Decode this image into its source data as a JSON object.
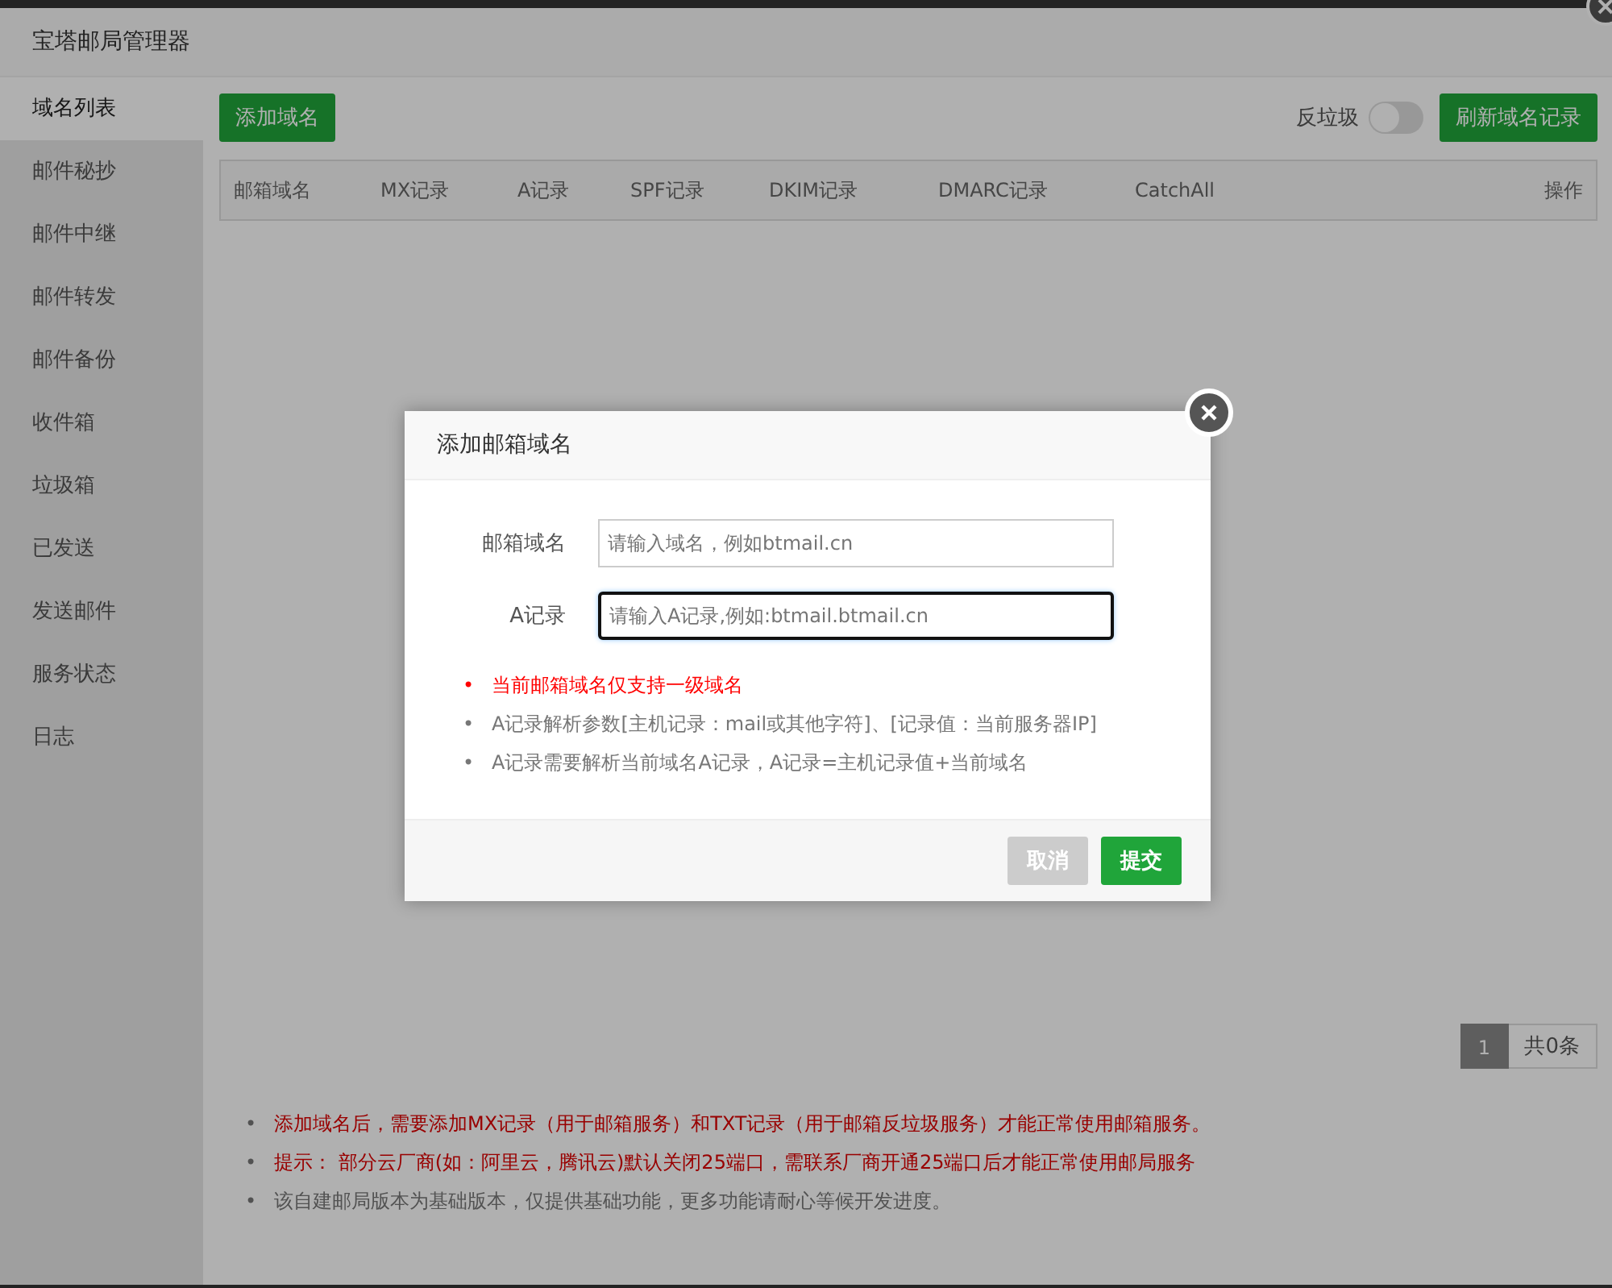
{
  "window": {
    "title": "宝塔邮局管理器"
  },
  "sidebar": {
    "items": [
      {
        "label": "域名列表",
        "selected": true
      },
      {
        "label": "邮件秘抄",
        "selected": false
      },
      {
        "label": "邮件中继",
        "selected": false
      },
      {
        "label": "邮件转发",
        "selected": false
      },
      {
        "label": "邮件备份",
        "selected": false
      },
      {
        "label": "收件箱",
        "selected": false
      },
      {
        "label": "垃圾箱",
        "selected": false
      },
      {
        "label": "已发送",
        "selected": false
      },
      {
        "label": "发送邮件",
        "selected": false
      },
      {
        "label": "服务状态",
        "selected": false
      },
      {
        "label": "日志",
        "selected": false
      }
    ]
  },
  "toolbar": {
    "add_button": "添加域名",
    "antispam": {
      "label": "反垃圾",
      "on": false
    },
    "refresh_button": "刷新域名记录"
  },
  "table": {
    "columns": [
      "邮箱域名",
      "MX记录",
      "A记录",
      "SPF记录",
      "DKIM记录",
      "DMARC记录",
      "CatchAll",
      "操作"
    ]
  },
  "pagination": {
    "pages": [
      {
        "label": "1",
        "selected": true
      }
    ],
    "total": "共0条"
  },
  "notes": [
    {
      "kind": "warning",
      "marker": "•",
      "text": "添加域名后，需要添加MX记录（用于邮箱服务）和TXT记录（用于邮箱反垃圾服务）才能正常使用邮箱服务。"
    },
    {
      "kind": "warning",
      "marker": "•",
      "text": "提示： 部分云厂商(如：阿里云，腾讯云)默认关闭25端口，需联系厂商开通25端口后才能正常使用邮局服务"
    },
    {
      "kind": "info",
      "marker": "•",
      "text": "该自建邮局版本为基础版本，仅提供基础功能，更多功能请耐心等候开发进度。"
    }
  ],
  "dialog": {
    "title": "添加邮箱域名",
    "fields": [
      {
        "label": "邮箱域名",
        "placeholder": "请输入域名，例如btmail.cn",
        "focused": false
      },
      {
        "label": "A记录",
        "placeholder": "请输入A记录,例如:btmail.btmail.cn",
        "focused": true
      }
    ],
    "notes": [
      {
        "kind": "warning",
        "marker": "•",
        "text": "当前邮箱域名仅支持一级域名"
      },
      {
        "kind": "info",
        "marker": "•",
        "text": "A记录解析参数[主机记录：mail或其他字符]、[记录值：当前服务器IP]"
      },
      {
        "kind": "info",
        "marker": "•",
        "text": "A记录需要解析当前域名A记录，A记录=主机记录值+当前域名"
      }
    ],
    "buttons": [
      {
        "label": "取消",
        "kind": "cancel"
      },
      {
        "label": "提交",
        "kind": "primary"
      }
    ]
  }
}
